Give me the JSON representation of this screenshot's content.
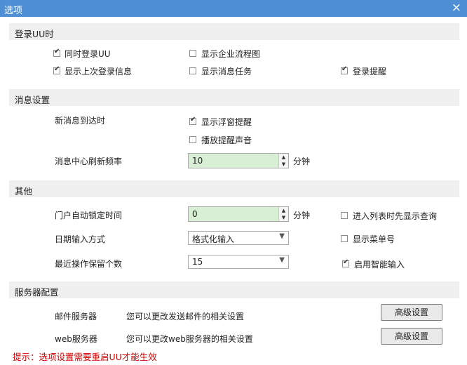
{
  "window": {
    "title": "选项",
    "close_glyph": "×"
  },
  "sections": {
    "login": "登录UU时",
    "message": "消息设置",
    "other": "其他",
    "server": "服务器配置"
  },
  "login": {
    "sync_login": {
      "label": "同时登录UU",
      "checked": true
    },
    "show_flow": {
      "label": "显示企业流程图",
      "checked": false
    },
    "show_last_login": {
      "label": "显示上次登录信息",
      "checked": true
    },
    "show_msg_task": {
      "label": "显示消息任务",
      "checked": false
    },
    "login_reminder": {
      "label": "登录提醒",
      "checked": true
    }
  },
  "message": {
    "new_msg_label": "新消息到达时",
    "float_reminder": {
      "label": "显示浮窗提醒",
      "checked": true
    },
    "sound_reminder": {
      "label": "播放提醒声音",
      "checked": false
    },
    "refresh_label": "消息中心刷新频率",
    "refresh_value": "10",
    "refresh_unit": "分钟"
  },
  "other": {
    "auto_lock_label": "门户自动锁定时间",
    "auto_lock_value": "0",
    "auto_lock_unit": "分钟",
    "show_query": {
      "label": "进入列表时先显示查询",
      "checked": false
    },
    "date_input_label": "日期输入方式",
    "date_input_value": "格式化输入",
    "show_menu_no": {
      "label": "显示菜单号",
      "checked": false
    },
    "recent_ops_label": "最近操作保留个数",
    "recent_ops_value": "15",
    "smart_input": {
      "label": "启用智能输入",
      "checked": true
    }
  },
  "server": {
    "mail_label": "邮件服务器",
    "mail_desc": "您可以更改发送邮件的相关设置",
    "mail_button": "高级设置",
    "web_label": "web服务器",
    "web_desc": "您可以更改web服务器的相关设置",
    "web_button": "高级设置"
  },
  "tip": "提示：选项设置需要重启UU才能生效"
}
